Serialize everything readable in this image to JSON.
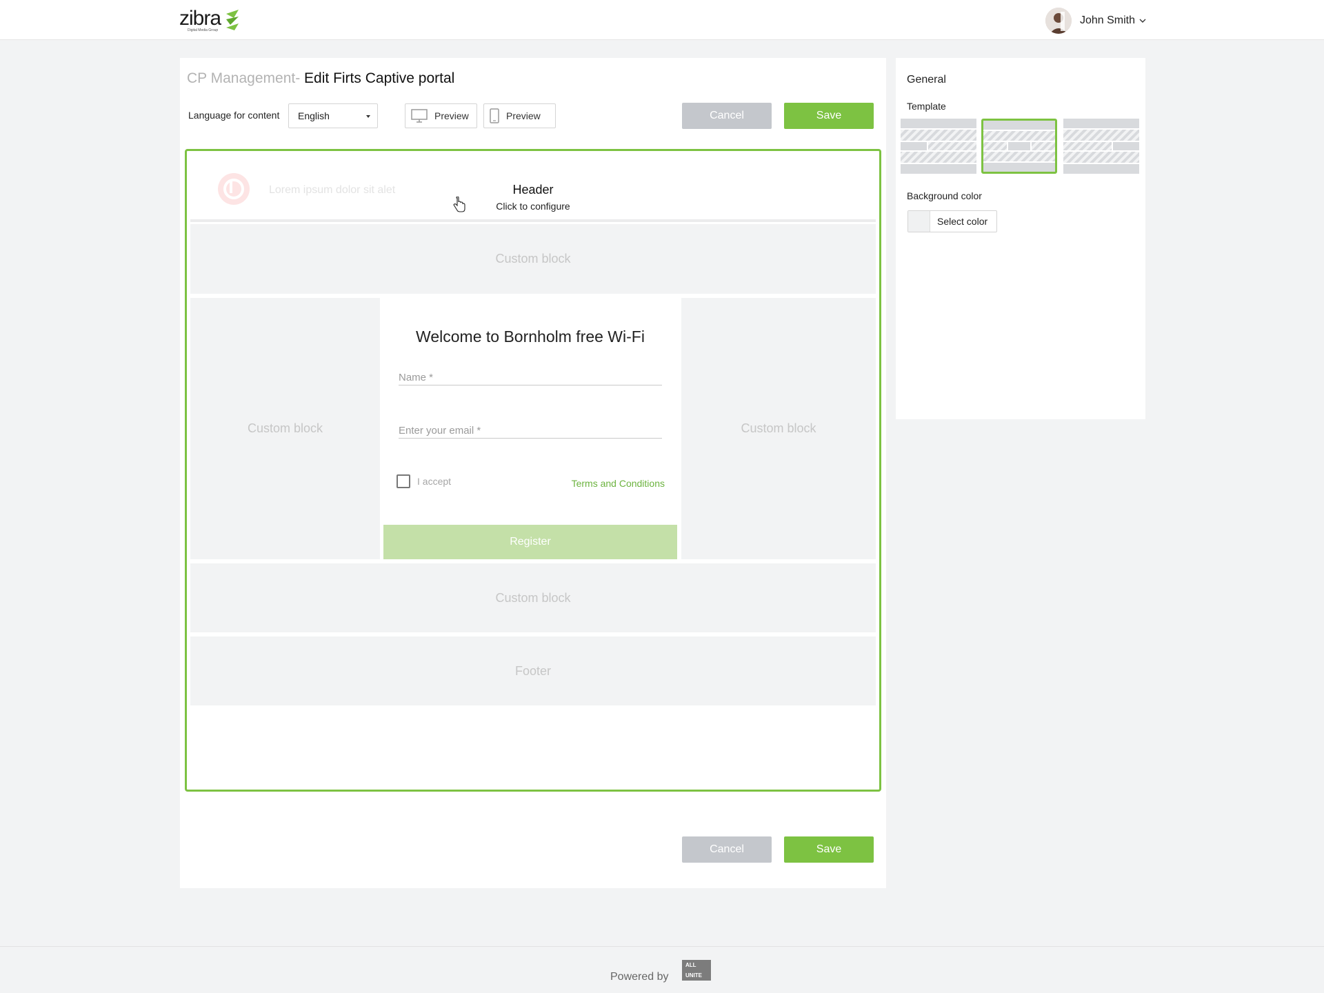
{
  "topbar": {
    "logo_text": "zibra",
    "logo_sub": "Digital Media Group",
    "user_name": "John Smith"
  },
  "page": {
    "breadcrumb": "CP Management-",
    "title": "Edit Firts Captive portal"
  },
  "toolbar": {
    "language_label": "Language for content",
    "language_value": "English",
    "desktop_preview": "Preview",
    "mobile_preview": "Preview",
    "cancel": "Cancel",
    "save": "Save"
  },
  "canvas": {
    "header": {
      "logo_text": "Lorem ipsum dolor sit alet",
      "title": "Header",
      "subtitle": "Click to configure"
    },
    "top_block": "Custom block",
    "left_block": "Custom block",
    "right_block": "Custom block",
    "bottom_block": "Custom block",
    "footer": "Footer",
    "form": {
      "title": "Welcome to Bornholm free Wi-Fi",
      "name_placeholder": "Name *",
      "email_placeholder": "Enter your email *",
      "accept_label": "I accept",
      "terms_link": "Terms and Conditions",
      "register": "Register"
    }
  },
  "bottom_actions": {
    "cancel": "Cancel",
    "save": "Save"
  },
  "side_panel": {
    "heading": "General",
    "template_label": "Template",
    "selected_template": 2,
    "background_label": "Background color",
    "select_color": "Select color",
    "swatch_color": "#f0f1f2"
  },
  "footer": {
    "powered_by": "Powered by",
    "brand_line1": "ALL",
    "brand_line2": "UNITE"
  },
  "colors": {
    "accent": "#7dc242",
    "cancel": "#c4c7cc"
  }
}
